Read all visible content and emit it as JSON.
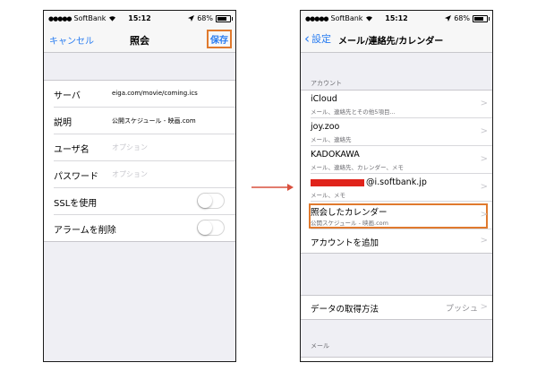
{
  "status_bar": {
    "signal_dots": "●●●●●",
    "carrier": "SoftBank",
    "time": "15:12",
    "battery_pct": "68%"
  },
  "left_screen": {
    "nav": {
      "cancel_label": "キャンセル",
      "title": "照会",
      "save_label": "保存"
    },
    "form": {
      "server_label": "サーバ",
      "server_value": "eiga.com/movie/coming.ics",
      "description_label": "説明",
      "description_value": "公開スケジュール - 映画.com",
      "username_label": "ユーザ名",
      "username_placeholder": "オプション",
      "password_label": "パスワード",
      "password_placeholder": "オプション",
      "ssl_label": "SSLを使用",
      "ssl_on": false,
      "alarm_label": "アラームを削除",
      "alarm_on": false
    }
  },
  "right_screen": {
    "nav": {
      "back_label": "設定",
      "title": "メール/連絡先/カレンダー"
    },
    "accounts_header": "アカウント",
    "accounts": [
      {
        "name": "iCloud",
        "detail": "メール、連絡先とその他5項目..."
      },
      {
        "name": "joy.zoo",
        "detail": "メール、連絡先"
      },
      {
        "name": "KADOKAWA",
        "detail": "メール、連絡先、カレンダー、メモ"
      },
      {
        "name_suffix": "@i.softbank.jp",
        "detail": "メール、メモ"
      },
      {
        "name": "照会したカレンダー",
        "detail": "公開スケジュール - 映画.com"
      }
    ],
    "add_account_label": "アカウントを追加",
    "fetch_label": "データの取得方法",
    "fetch_value": "プッシュ",
    "mail_header": "メール"
  },
  "colors": {
    "ios_blue": "#2a7df1",
    "highlight_orange": "#e07a2e",
    "arrow_red": "#d9503e"
  }
}
